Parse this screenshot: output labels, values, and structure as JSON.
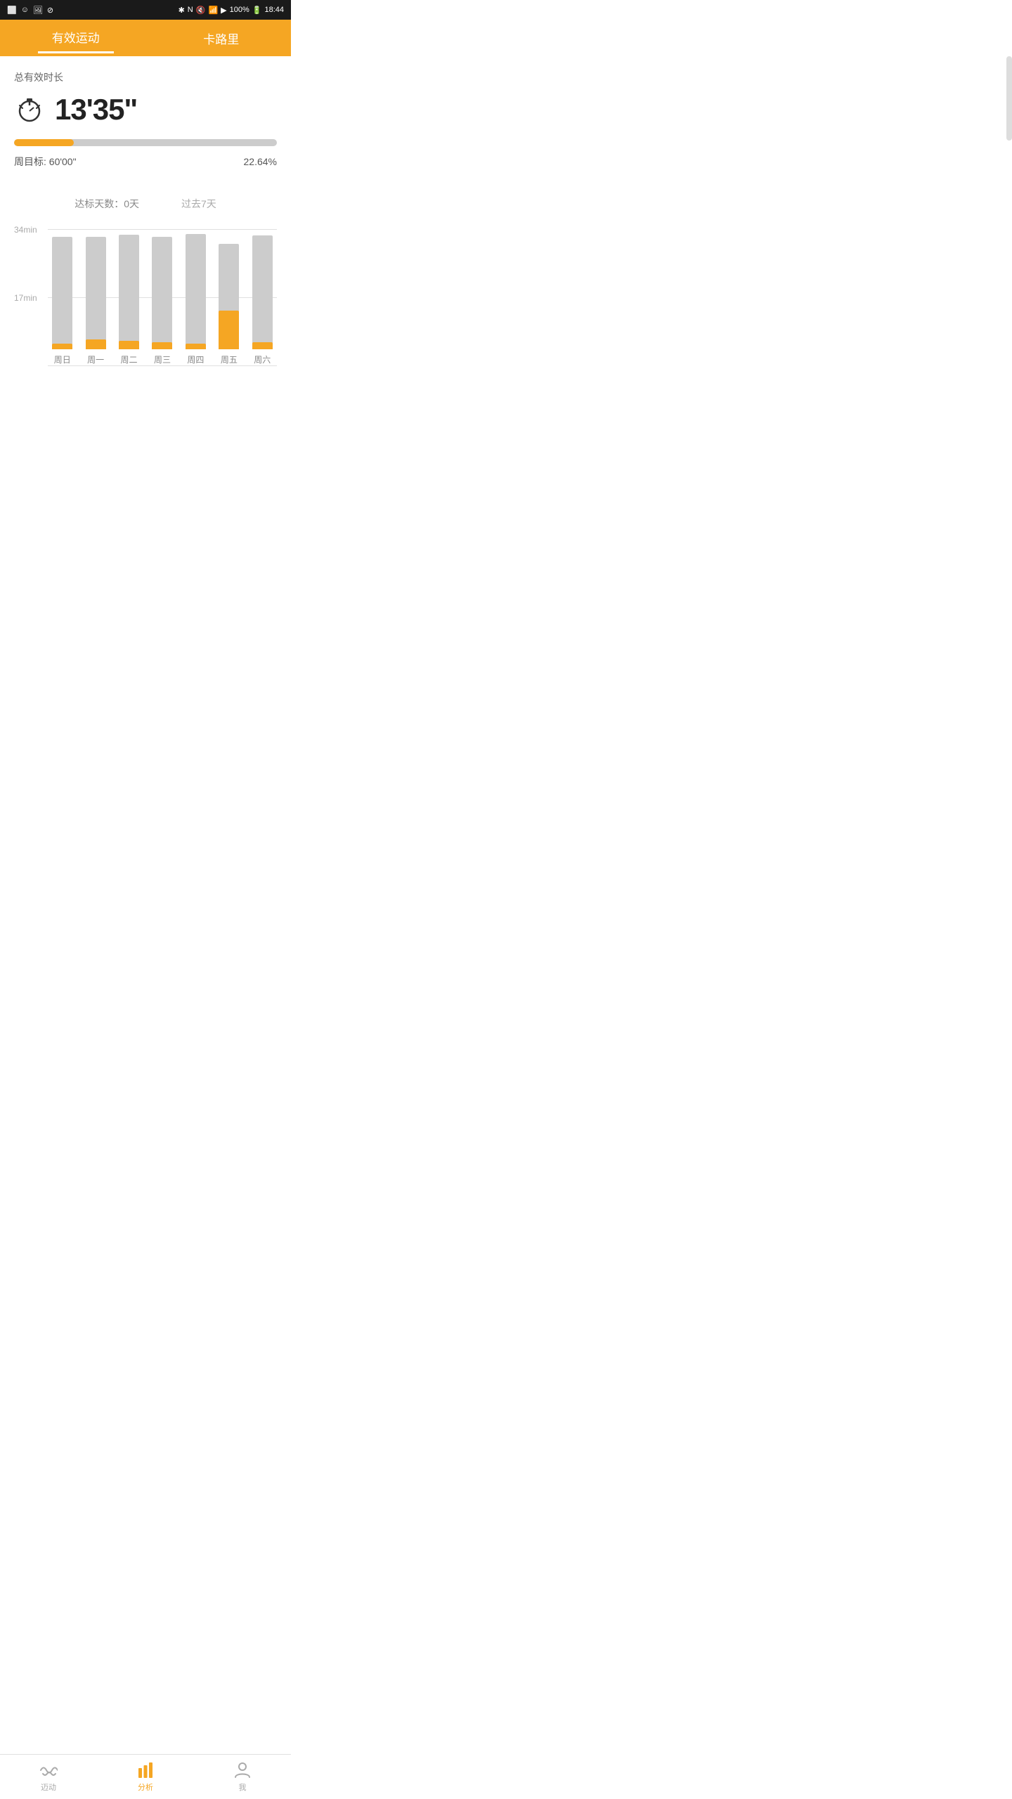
{
  "statusBar": {
    "time": "18:44",
    "battery": "100%",
    "icons": [
      "bluetooth",
      "N",
      "mute",
      "wifi",
      "signal"
    ]
  },
  "topTabs": {
    "items": [
      {
        "label": "有效运动",
        "active": true
      },
      {
        "label": "卡路里",
        "active": false
      }
    ]
  },
  "main": {
    "totalDurationLabel": "总有效时长",
    "duration": "13'35\"",
    "progressPercent": 22.64,
    "goalLabel": "周目标: 60'00\"",
    "goalPercent": "22.64%",
    "chartHeader": {
      "daysLabel": "达标天数：0天",
      "pastLabel": "过去7天"
    },
    "yAxis": {
      "top": "34min",
      "mid": "17min"
    },
    "bars": [
      {
        "day": "周日",
        "totalHeight": 160,
        "activeHeight": 8
      },
      {
        "day": "周一",
        "totalHeight": 160,
        "activeHeight": 14
      },
      {
        "day": "周二",
        "totalHeight": 163,
        "activeHeight": 12
      },
      {
        "day": "周三",
        "totalHeight": 160,
        "activeHeight": 10
      },
      {
        "day": "周四",
        "totalHeight": 164,
        "activeHeight": 8
      },
      {
        "day": "周五",
        "totalHeight": 150,
        "activeHeight": 55
      },
      {
        "day": "周六",
        "totalHeight": 162,
        "activeHeight": 10
      }
    ]
  },
  "bottomNav": {
    "items": [
      {
        "label": "迈动",
        "active": false,
        "icon": "activity"
      },
      {
        "label": "分析",
        "active": true,
        "icon": "chart"
      },
      {
        "label": "我",
        "active": false,
        "icon": "person"
      }
    ]
  }
}
